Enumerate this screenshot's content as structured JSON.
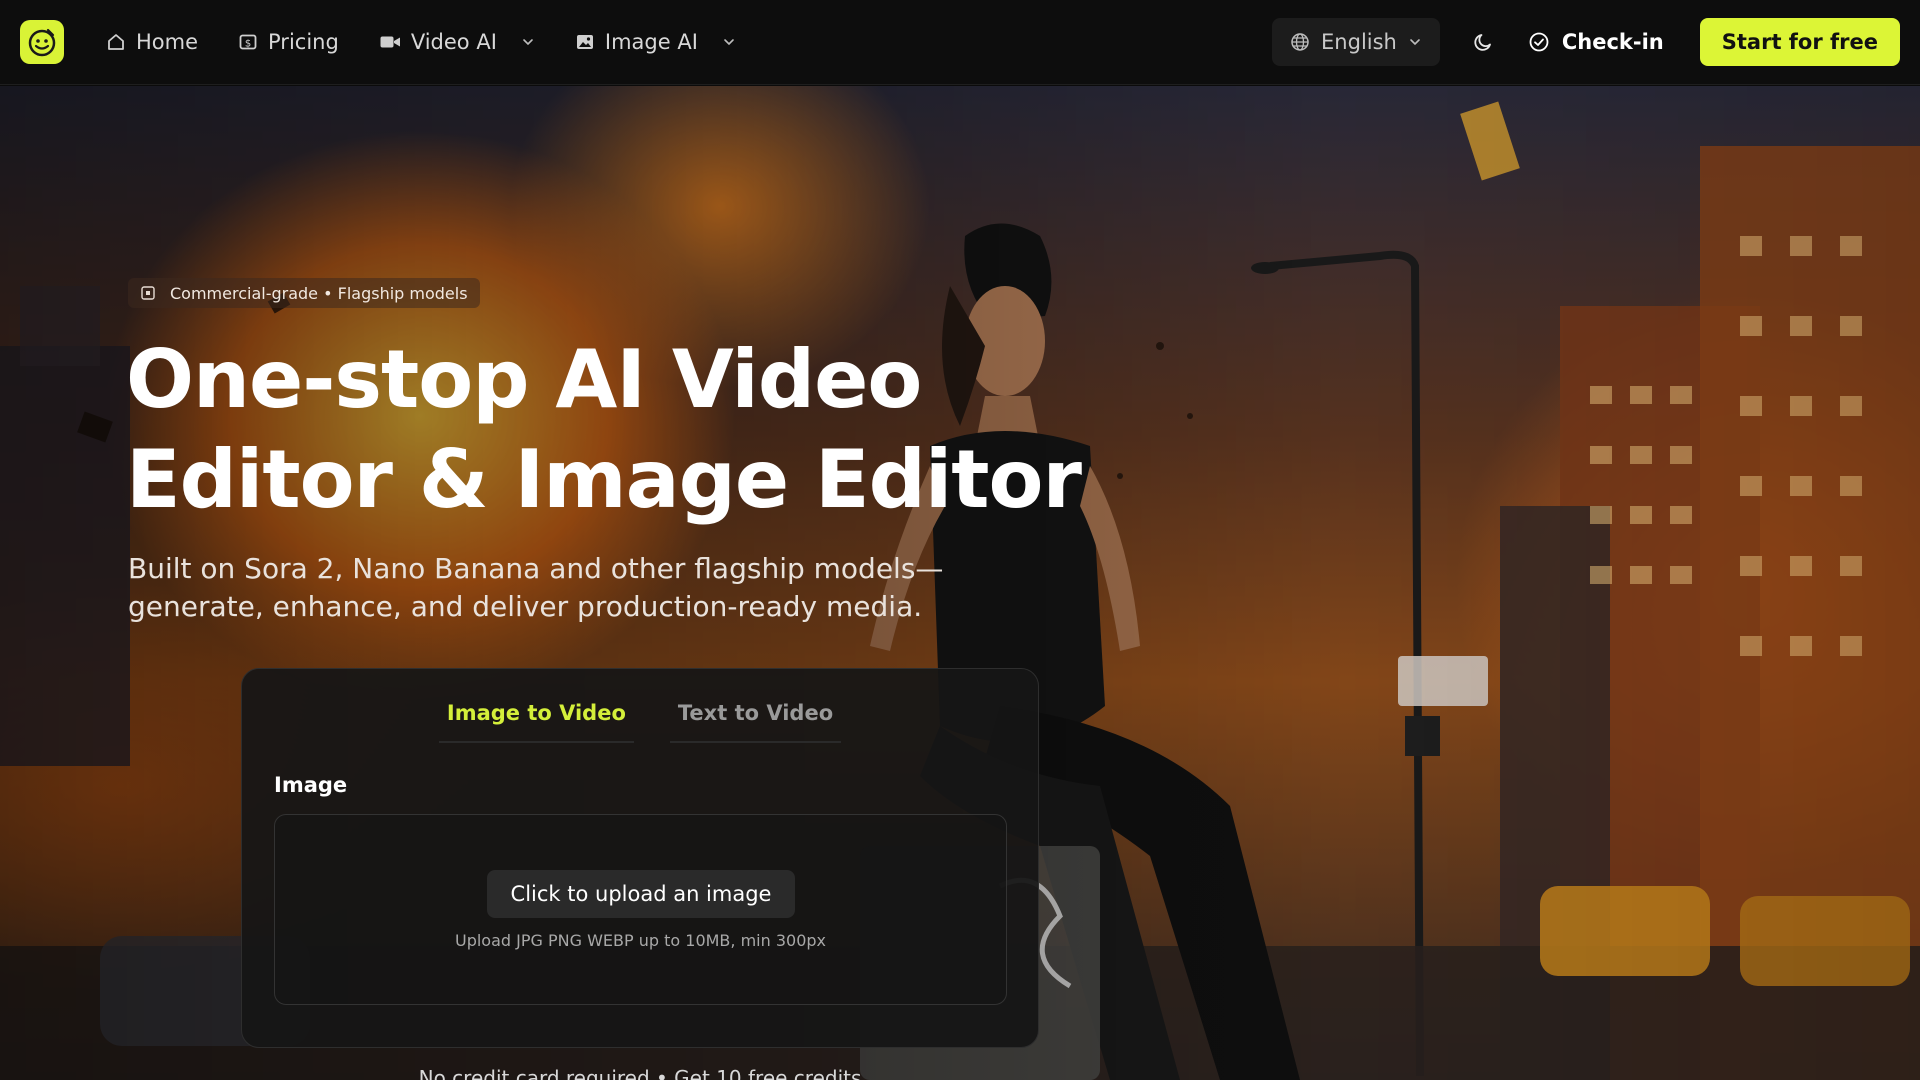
{
  "header": {
    "logo_icon": "bowl-face-logo",
    "nav": [
      {
        "label": "Home",
        "icon": "home-icon",
        "dropdown": false
      },
      {
        "label": "Pricing",
        "icon": "price-tag-icon",
        "dropdown": false
      },
      {
        "label": "Video AI",
        "icon": "video-camera-icon",
        "dropdown": true
      },
      {
        "label": "Image AI",
        "icon": "image-icon",
        "dropdown": true
      }
    ],
    "language": "English",
    "checkin_label": "Check-in",
    "start_label": "Start for free",
    "accent_color": "#dcf536"
  },
  "hero": {
    "badge": "Commercial-grade • Flagship models",
    "title_line1": "One-stop AI Video",
    "title_line2": "Editor & Image Editor",
    "subtitle_line1": "Built on Sora 2, Nano Banana and other flagship models—",
    "subtitle_line2": "generate, enhance, and deliver production-ready media."
  },
  "generator": {
    "tabs": [
      {
        "label": "Image to Video",
        "active": true
      },
      {
        "label": "Text to Video",
        "active": false
      }
    ],
    "field_label": "Image",
    "upload_button": "Click to upload an image",
    "upload_hint": "Upload JPG PNG WEBP up to 10MB, min 300px"
  },
  "footer_note": "No credit card required • Get 10 free credits"
}
